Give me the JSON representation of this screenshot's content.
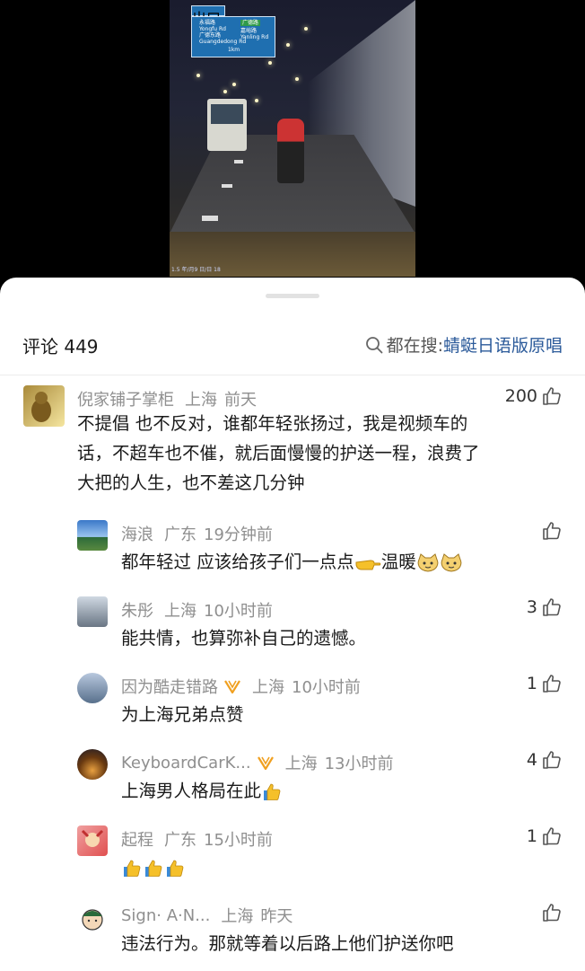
{
  "video": {
    "sign_top": "出口",
    "sign_left_1": "永福路",
    "sign_left_2": "Yongfu Rd",
    "sign_left_3": "广德东路",
    "sign_left_4": "Guangdedong Rd",
    "sign_right_1": "广德路",
    "sign_right_2": "嘉峪路",
    "sign_right_3": "Yanling Rd",
    "sign_distance": "1km",
    "dash_text": "1.5 年/月9 日/日 18"
  },
  "header": {
    "title": "评论 449",
    "search_label": "都在搜: ",
    "search_keyword": "蜻蜓日语版原唱"
  },
  "comments": [
    {
      "name": "倪家铺子掌柜",
      "location": "上海",
      "time": "前天",
      "likes": "200",
      "lines": [
        "不提倡 也不反对，谁都年轻张扬过，我是视频车的",
        "话，不超车也不催，就后面慢慢的护送一程，浪费了",
        "大把的人生，也不差这几分钟"
      ]
    },
    {
      "name": "海浪",
      "location": "广东",
      "time": "19分钟前",
      "likes": "",
      "text": "都年轻过 应该给孩子们一点点",
      "text_after": "温暖"
    },
    {
      "name": "朱彤",
      "location": "上海",
      "time": "10小时前",
      "likes": "3",
      "text": "能共情，也算弥补自己的遗憾。"
    },
    {
      "name": "因为酷走错路",
      "location": "上海",
      "time": "10小时前",
      "likes": "1",
      "text": "为上海兄弟点赞"
    },
    {
      "name": "KeyboardCarK...",
      "location": "上海",
      "time": "13小时前",
      "likes": "4",
      "text": "上海男人格局在此"
    },
    {
      "name": "起程",
      "location": "广东",
      "time": "15小时前",
      "likes": "1",
      "text": ""
    },
    {
      "name": "Sign· A·N...",
      "location": "上海",
      "time": "昨天",
      "likes": "",
      "text": "违法行为。那就等着以后路上他们护送你吧"
    }
  ],
  "colors": {
    "accent_link": "#2b5a9a",
    "meta_gray": "#8f8f8f",
    "badge_orange": "#f0a020",
    "thumb_yellow": "#f5c02a"
  },
  "icons": [
    "search-icon",
    "thumbs-up-outline-icon",
    "vip-badge-icon",
    "thumbs-up-emoji",
    "pointing-hand-emoji",
    "cat-face-emoji"
  ]
}
